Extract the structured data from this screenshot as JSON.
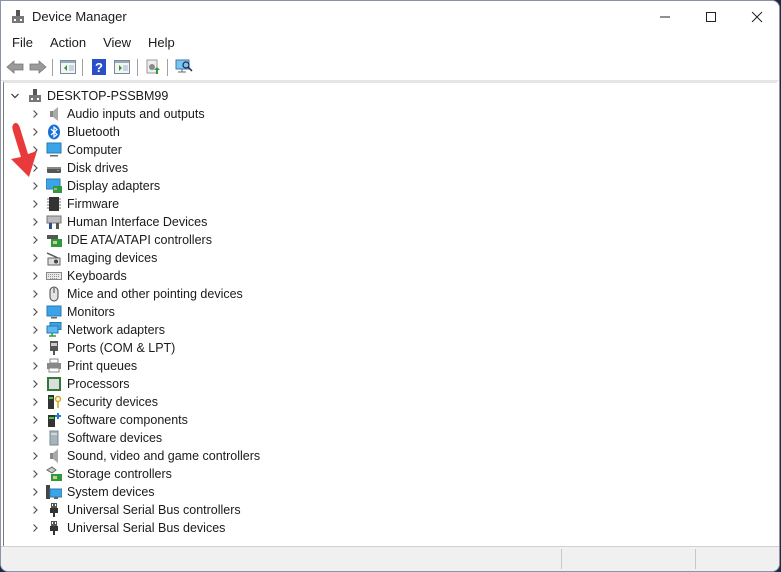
{
  "window": {
    "title": "Device Manager",
    "controls": {
      "minimize": "minimize",
      "maximize": "maximize",
      "close": "close"
    }
  },
  "menu": [
    "File",
    "Action",
    "View",
    "Help"
  ],
  "toolbar": {
    "buttons": [
      "back",
      "forward",
      "show-hide-console-tree",
      "help",
      "properties-pane",
      "update-driver",
      "scan-hardware-changes"
    ]
  },
  "tree": {
    "root": "DESKTOP-PSSBM99",
    "categories": [
      {
        "label": "Audio inputs and outputs",
        "icon": "speaker-icon"
      },
      {
        "label": "Bluetooth",
        "icon": "bluetooth-icon"
      },
      {
        "label": "Computer",
        "icon": "computer-icon"
      },
      {
        "label": "Disk drives",
        "icon": "disk-drive-icon"
      },
      {
        "label": "Display adapters",
        "icon": "display-adapter-icon"
      },
      {
        "label": "Firmware",
        "icon": "firmware-chip-icon"
      },
      {
        "label": "Human Interface Devices",
        "icon": "hid-icon"
      },
      {
        "label": "IDE ATA/ATAPI controllers",
        "icon": "ide-controller-icon"
      },
      {
        "label": "Imaging devices",
        "icon": "camera-icon"
      },
      {
        "label": "Keyboards",
        "icon": "keyboard-icon"
      },
      {
        "label": "Mice and other pointing devices",
        "icon": "mouse-icon"
      },
      {
        "label": "Monitors",
        "icon": "monitor-icon"
      },
      {
        "label": "Network adapters",
        "icon": "network-adapter-icon"
      },
      {
        "label": "Ports (COM & LPT)",
        "icon": "port-icon"
      },
      {
        "label": "Print queues",
        "icon": "printer-icon"
      },
      {
        "label": "Processors",
        "icon": "processor-icon"
      },
      {
        "label": "Security devices",
        "icon": "security-key-icon"
      },
      {
        "label": "Software components",
        "icon": "software-component-icon"
      },
      {
        "label": "Software devices",
        "icon": "software-device-icon"
      },
      {
        "label": "Sound, video and game controllers",
        "icon": "speaker-icon"
      },
      {
        "label": "Storage controllers",
        "icon": "storage-controller-icon"
      },
      {
        "label": "System devices",
        "icon": "system-devices-icon"
      },
      {
        "label": "Universal Serial Bus controllers",
        "icon": "usb-icon"
      },
      {
        "label": "Universal Serial Bus devices",
        "icon": "usb-icon"
      }
    ]
  },
  "annotation": {
    "arrow_color": "#e83a3a"
  },
  "colors": {
    "accent": "#0078d7",
    "monitor_blue": "#3ba3e8",
    "pcb_green": "#2e9a3a"
  }
}
